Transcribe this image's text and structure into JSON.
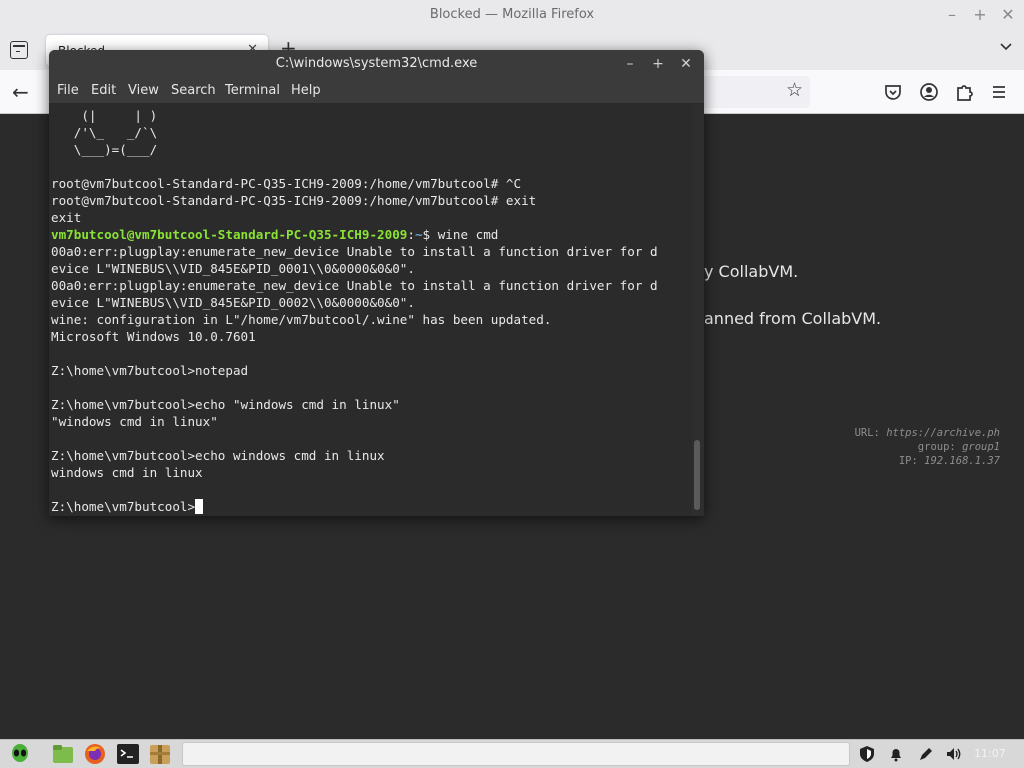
{
  "firefox": {
    "window_title": "Blocked — Mozilla Firefox",
    "tab_title": "Blocked",
    "content_text": {
      "line1": "y CollabVM.",
      "line2": "anned from CollabVM."
    },
    "meta": {
      "url_label": "URL:",
      "url_value": "https://archive.ph",
      "group_label": "group:",
      "group_value": "group1",
      "ip_label": "IP:",
      "ip_value": "192.168.1.37"
    }
  },
  "terminal": {
    "title": "C:\\windows\\system32\\cmd.exe",
    "menu": [
      "File",
      "Edit",
      "View",
      "Search",
      "Terminal",
      "Help"
    ],
    "lines": [
      "    (|     | )",
      "   /'\\_   _/`\\",
      "   \\___)=(___/",
      "",
      "root@vm7butcool-Standard-PC-Q35-ICH9-2009:/home/vm7butcool# ^C",
      "root@vm7butcool-Standard-PC-Q35-ICH9-2009:/home/vm7butcool# exit",
      "exit"
    ],
    "prompt_user": "vm7butcool@vm7butcool-Standard-PC-Q35-ICH9-2009",
    "prompt_sep": ":",
    "prompt_path": "~",
    "prompt_cmd": "$ wine cmd",
    "output_lines": [
      "00a0:err:plugplay:enumerate_new_device Unable to install a function driver for d",
      "evice L\"WINEBUS\\\\VID_845E&PID_0001\\\\0&0000&0&0\".",
      "00a0:err:plugplay:enumerate_new_device Unable to install a function driver for d",
      "evice L\"WINEBUS\\\\VID_845E&PID_0002\\\\0&0000&0&0\".",
      "wine: configuration in L\"/home/vm7butcool/.wine\" has been updated.",
      "Microsoft Windows 10.0.7601",
      "",
      "Z:\\home\\vm7butcool>notepad",
      "",
      "Z:\\home\\vm7butcool>echo \"windows cmd in linux\"",
      "\"windows cmd in linux\"",
      "",
      "Z:\\home\\vm7butcool>echo windows cmd in linux",
      "windows cmd in linux",
      ""
    ],
    "current_prompt": "Z:\\home\\vm7butcool>"
  },
  "panel": {
    "clock": "11:07",
    "launchers": [
      "menu-icon",
      "files-icon",
      "firefox-icon",
      "terminal-icon",
      "archive-icon"
    ]
  },
  "colors": {
    "prompt_user": "#8ae234",
    "prompt_path": "#6a9fd1",
    "terminal_bg": "#2b2b2b"
  }
}
